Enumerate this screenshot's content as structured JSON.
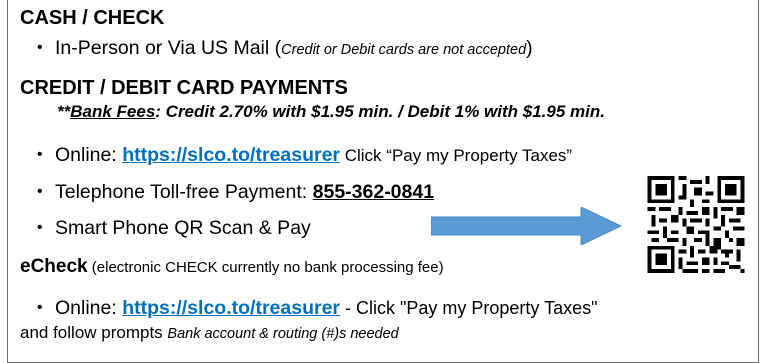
{
  "cash_check": {
    "heading": "CASH / CHECK",
    "bullet_main": "In-Person or Via US Mail (",
    "bullet_note": "Credit or Debit cards are not accepted",
    "bullet_close": ")"
  },
  "card_payments": {
    "heading": "CREDIT / DEBIT CARD PAYMENTS",
    "fees_prefix": "**",
    "fees_label": "Bank Fees",
    "fees_text": ": Credit 2.70% with $1.95 min. / Debit 1% with $1.95 min.",
    "online_label": "Online: ",
    "online_link": "https://slco.to/treasurer",
    "online_suffix": " Click “Pay my Property Taxes”",
    "phone_label": "Telephone Toll-free Payment:  ",
    "phone_number": "855-362-0841",
    "qr_label": "Smart Phone QR Scan & Pay"
  },
  "echeck": {
    "heading": "eCheck",
    "note": " (electronic CHECK currently no bank processing fee)",
    "online_label": "Online: ",
    "online_link": "https://slco.to/treasurer",
    "online_suffix": " - Click \"Pay my Property Taxes\"",
    "follow_text": "and follow prompts ",
    "follow_note": "Bank account & routing (#)s needed"
  },
  "colors": {
    "link": "#0070c0",
    "arrow_fill": "#5b9bd5",
    "border": "#6e6e6e"
  },
  "icons": {
    "arrow": "right-arrow-icon",
    "qr": "qr-code-icon"
  }
}
